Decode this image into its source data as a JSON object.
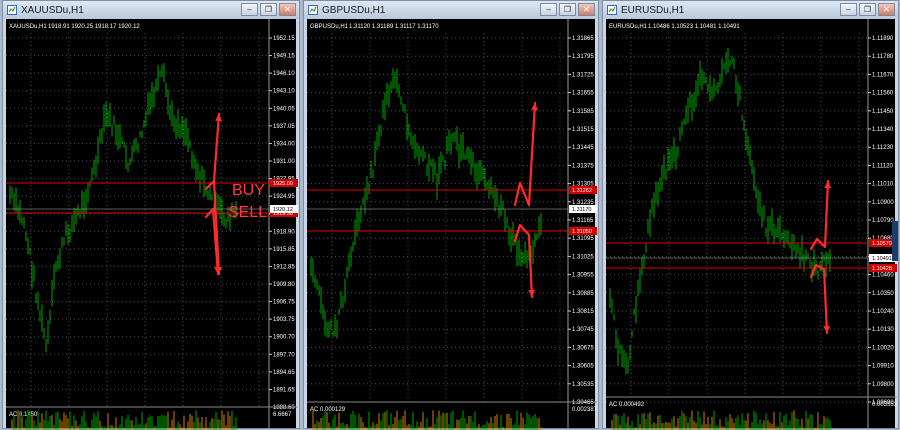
{
  "colors": {
    "candle": "#00a800",
    "line": "#e00000",
    "arrow": "#ff2a2a",
    "chart_bg": "#000000",
    "ac_up": "#00a800",
    "ac_down": "#d08000"
  },
  "windows": [
    {
      "id": "xau",
      "title": "XAUUSDu,H1",
      "header_symbol": "XAUUSDu,H1",
      "header_ohlc": "1918.91 1920.25 1918.17 1920.12",
      "price_labels": [
        "1952.15",
        "1949.15",
        "1946.10",
        "1943.10",
        "1940.05",
        "1937.05",
        "1934.00",
        "1931.00",
        "1927.95",
        "1924.95",
        "1921.90",
        "1918.90",
        "1915.85",
        "1912.85",
        "1909.80",
        "1906.75",
        "1903.75",
        "1900.70",
        "1897.70",
        "1894.65",
        "1891.65",
        "1888.60"
      ],
      "buy_tag": "1925.00",
      "sell_tag": "1919.50",
      "current_tag": "1920.12",
      "annot_buy": "BUY",
      "annot_sell": "SELL",
      "ac_label": "AC 0.1450",
      "ac_value": "6.6667"
    },
    {
      "id": "gbp",
      "title": "GBPUSDu,H1",
      "header_symbol": "GBPUSDu,H1",
      "header_ohlc": "1.31120 1.31189 1.31117 1.31170",
      "price_labels": [
        "1.31865",
        "1.31795",
        "1.31725",
        "1.31655",
        "1.31585",
        "1.31515",
        "1.31445",
        "1.31375",
        "1.31305",
        "1.31235",
        "1.31165",
        "1.31095",
        "1.31025",
        "1.30955",
        "1.30885",
        "1.30815",
        "1.30745",
        "1.30675",
        "1.30605",
        "1.30535",
        "1.30465"
      ],
      "buy_tag": "1.31262",
      "sell_tag": "1.31050",
      "current_tag": "1.31170",
      "ac_label": "AC 0.000129",
      "ac_value": "0.0023875"
    },
    {
      "id": "eur",
      "title": "EURUSDu,H1",
      "header_symbol": "EURUSDu,H1",
      "header_ohlc": "1.10486 1.10523 1.10481 1.10491",
      "price_labels": [
        "1.11890",
        "1.11780",
        "1.11670",
        "1.11560",
        "1.11450",
        "1.11340",
        "1.11230",
        "1.11120",
        "1.11010",
        "1.10900",
        "1.10790",
        "1.10680",
        "1.10570",
        "1.10460",
        "1.10350",
        "1.10240",
        "1.10130",
        "1.10020",
        "1.09910",
        "1.09800",
        "1.09690"
      ],
      "buy_tag": "1.10570",
      "sell_tag": "1.10428",
      "current_tag": "1.10491",
      "ac_label": "AC 0.000492",
      "ac_value": "0.0035532"
    }
  ]
}
